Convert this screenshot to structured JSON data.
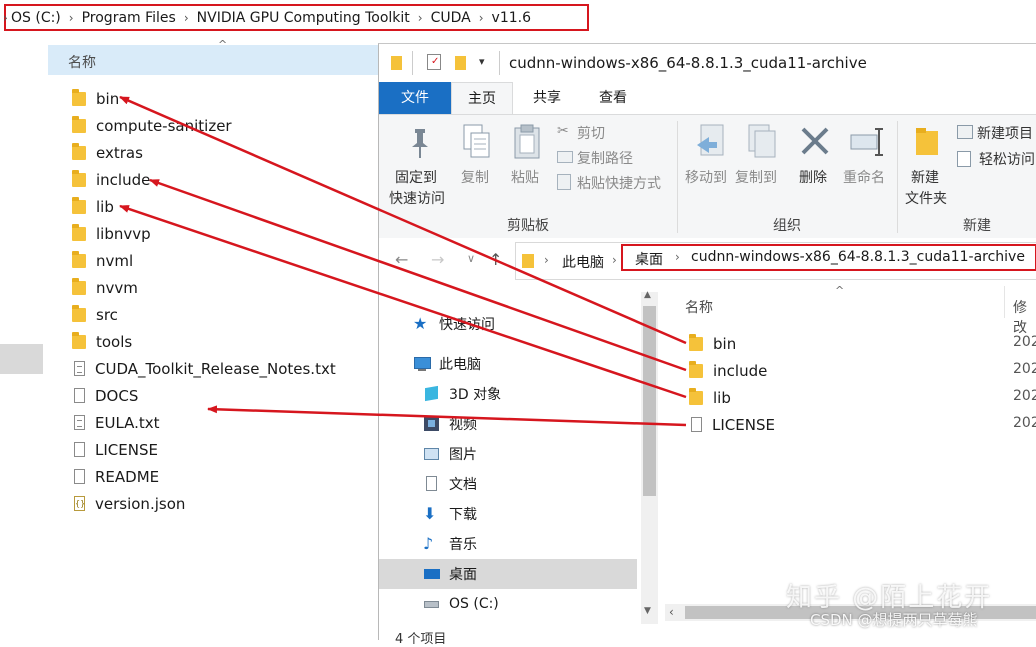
{
  "back_window": {
    "breadcrumb": [
      "OS (C:)",
      "Program Files",
      "NVIDIA GPU Computing Toolkit",
      "CUDA",
      "v11.6"
    ],
    "column_header": "名称",
    "files": [
      {
        "name": "bin",
        "kind": "folder"
      },
      {
        "name": "compute-sanitizer",
        "kind": "folder"
      },
      {
        "name": "extras",
        "kind": "folder"
      },
      {
        "name": "include",
        "kind": "folder"
      },
      {
        "name": "lib",
        "kind": "folder"
      },
      {
        "name": "libnvvp",
        "kind": "folder"
      },
      {
        "name": "nvml",
        "kind": "folder"
      },
      {
        "name": "nvvm",
        "kind": "folder"
      },
      {
        "name": "src",
        "kind": "folder"
      },
      {
        "name": "tools",
        "kind": "folder"
      },
      {
        "name": "CUDA_Toolkit_Release_Notes.txt",
        "kind": "txt"
      },
      {
        "name": "DOCS",
        "kind": "file"
      },
      {
        "name": "EULA.txt",
        "kind": "txt"
      },
      {
        "name": "LICENSE",
        "kind": "file"
      },
      {
        "name": "README",
        "kind": "file"
      },
      {
        "name": "version.json",
        "kind": "json"
      }
    ]
  },
  "front_window": {
    "title": "cudnn-windows-x86_64-8.8.1.3_cuda11-archive",
    "tabs": {
      "file": "文件",
      "home": "主页",
      "share": "共享",
      "view": "查看"
    },
    "ribbon": {
      "pin_quick_access": [
        "固定到",
        "快速访问"
      ],
      "copy": "复制",
      "paste": "粘贴",
      "cut": "剪切",
      "copy_path": "复制路径",
      "paste_shortcut": "粘贴快捷方式",
      "clipboard_group": "剪贴板",
      "move_to": "移动到",
      "copy_to": "复制到",
      "delete": "删除",
      "rename": "重命名",
      "organize_group": "组织",
      "new_folder": [
        "新建",
        "文件夹"
      ],
      "new_item": "新建项目",
      "easy_access": "轻松访问",
      "new_group": "新建"
    },
    "address": [
      "此电脑",
      "桌面",
      "cudnn-windows-x86_64-8.8.1.3_cuda11-archive"
    ],
    "nav": {
      "quick_access": "快速访问",
      "this_pc": "此电脑",
      "objects3d": "3D 对象",
      "videos": "视频",
      "pictures": "图片",
      "documents": "文档",
      "downloads": "下载",
      "music": "音乐",
      "desktop": "桌面",
      "os_drive": "OS (C:)"
    },
    "columns": {
      "name": "名称",
      "modified": "修改"
    },
    "files": [
      {
        "name": "bin",
        "kind": "folder",
        "date": "202"
      },
      {
        "name": "include",
        "kind": "folder",
        "date": "202"
      },
      {
        "name": "lib",
        "kind": "folder",
        "date": "202"
      },
      {
        "name": "LICENSE",
        "kind": "file",
        "date": "202"
      }
    ],
    "status": "4 个项目"
  },
  "watermark": {
    "line1": "知乎 @陌上花开",
    "line2": "CSDN @想提两只草莓熊"
  },
  "colors": {
    "highlight_red": "#d6161e",
    "file_tab_blue": "#1a6fc4",
    "folder_yellow": "#f5c23a"
  }
}
